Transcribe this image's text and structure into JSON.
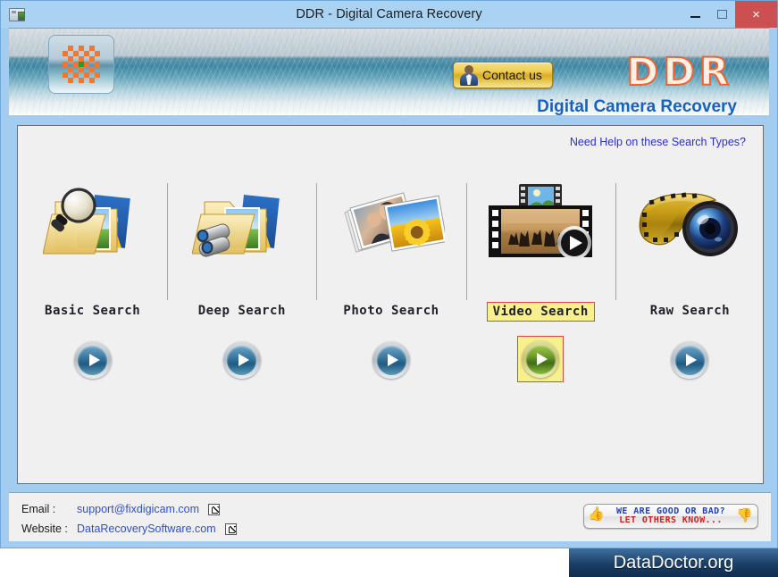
{
  "window": {
    "title": "DDR - Digital Camera Recovery",
    "icon": "camera-icon",
    "controls": {
      "minimize": "–",
      "maximize": "",
      "close": "×"
    }
  },
  "header": {
    "app_logo_icon": "checkerboard-logo-icon",
    "contact_button": {
      "label": "Contact us",
      "icon": "person-avatar-icon"
    },
    "brand": "DDR",
    "brand_subtitle": "Digital Camera Recovery",
    "brand_color": "#f4622a",
    "subtitle_color": "#1761c0"
  },
  "main": {
    "help_link": "Need Help on these Search Types?",
    "help_link_color": "#2c2cd4",
    "selected_type": "Video Search",
    "highlight_bg": "#f7f08c",
    "highlight_border": "#e04545",
    "search_types": [
      {
        "label": "Basic Search",
        "icon": "folder-magnifier-icon",
        "selected": false,
        "action": "start-basic-search"
      },
      {
        "label": "Deep Search",
        "icon": "folder-binoculars-icon",
        "selected": false,
        "action": "start-deep-search"
      },
      {
        "label": "Photo Search",
        "icon": "photo-stack-icon",
        "selected": false,
        "action": "start-photo-search"
      },
      {
        "label": "Video Search",
        "icon": "film-strip-video-icon",
        "selected": true,
        "action": "start-video-search"
      },
      {
        "label": "Raw Search",
        "icon": "film-reel-lens-icon",
        "selected": false,
        "action": "start-raw-search"
      }
    ]
  },
  "footer": {
    "email_key": "Email :",
    "email_value": "support@fixdigicam.com",
    "website_key": "Website :",
    "website_value": "DataRecoverySoftware.com",
    "link_color": "#2b4fd8",
    "external_icon": "external-link-icon",
    "feedback": {
      "line1": "WE  ARE  GOOD  OR  BAD?",
      "line2": "LET OTHERS KNOW...",
      "line1_color": "#1f3fb5",
      "line2_color": "#cf1f1f",
      "thumb_up_icon": "thumbs-up-icon",
      "thumb_down_icon": "thumbs-down-icon"
    }
  },
  "watermark": {
    "text": "DataDoctor.org"
  }
}
